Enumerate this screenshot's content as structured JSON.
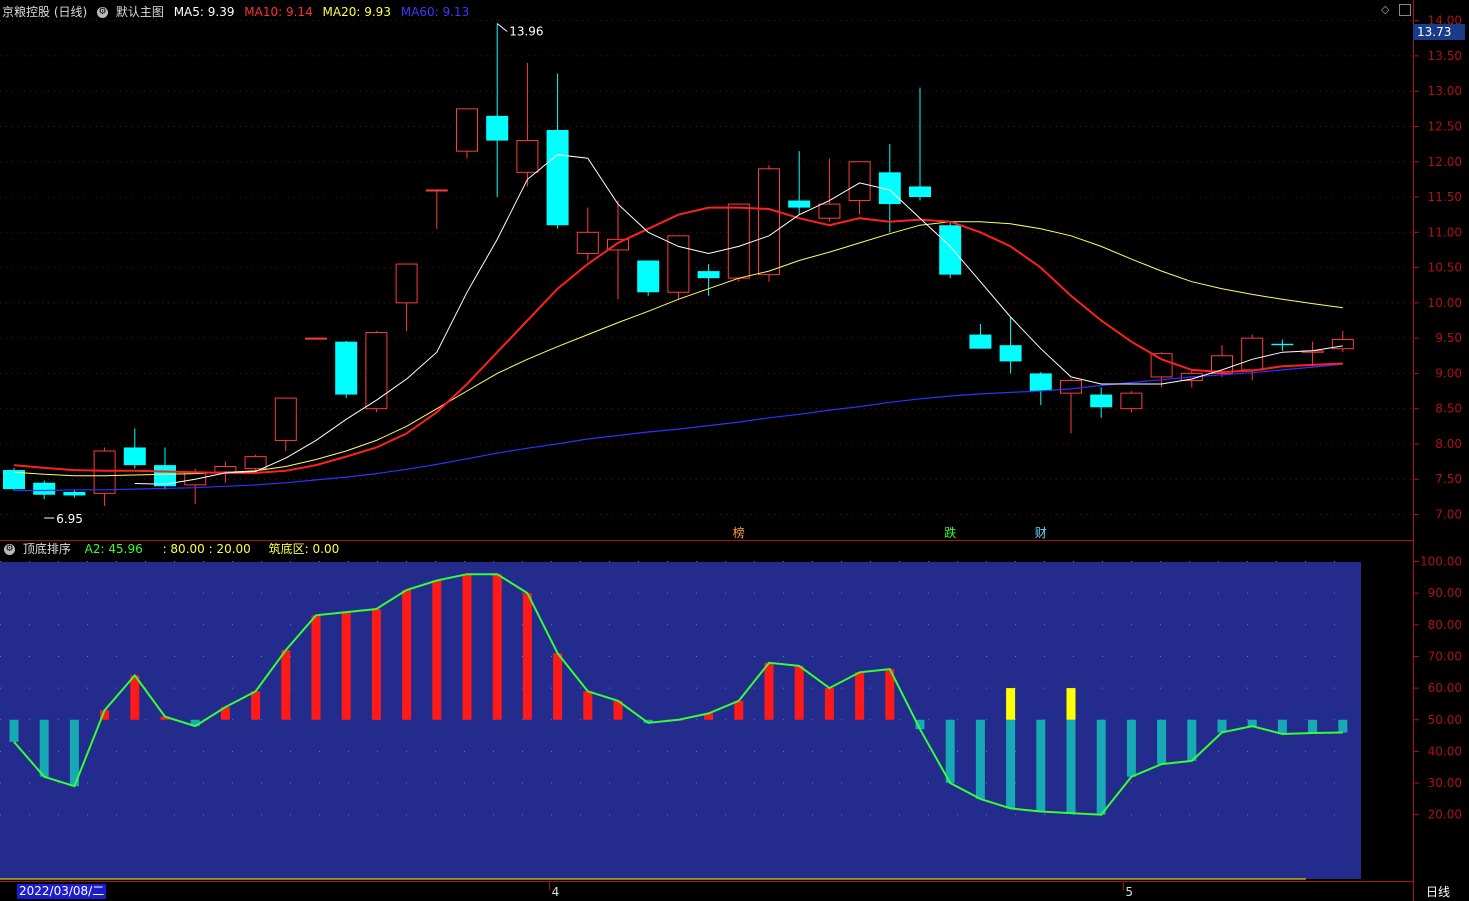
{
  "main_header": {
    "stock": "京粮控股 (日线)",
    "template": "默认主图",
    "ma5": "MA5: 9.39",
    "ma10": "MA10: 9.14",
    "ma20": "MA20: 9.93",
    "ma60": "MA60: 9.13"
  },
  "sub_header": {
    "title": "顶底排序",
    "a2": "A2: 45.96",
    "bounds": ": 80.00 : 20.00",
    "bottom": "筑底区: 0.00"
  },
  "current_price": "13.73",
  "bottom_bar": {
    "date": "2022/03/08/二",
    "period": "日线"
  },
  "colors": {
    "up": "#ff3b3b",
    "down": "#00ffff",
    "ma5": "#ffffff",
    "ma10": "#ff2020",
    "ma20": "#ffff66",
    "ma60": "#3030ff",
    "sub_bg": "#232b8c",
    "osc_line": "#33ff33",
    "osc_up": "#ff1a1a",
    "osc_down": "#17aab5",
    "osc_flag": "#ffff00",
    "axis": "#b01010"
  },
  "chart_data": [
    {
      "type": "candlestick",
      "ylim": [
        6.8,
        14.1
      ],
      "yticks": [
        7.0,
        7.5,
        8.0,
        8.5,
        9.0,
        9.5,
        10.0,
        10.5,
        11.0,
        11.5,
        12.0,
        12.5,
        13.0,
        13.5,
        14.0
      ],
      "ohlc": [
        [
          7.63,
          7.66,
          7.34,
          7.36
        ],
        [
          7.45,
          7.48,
          7.22,
          7.28
        ],
        [
          7.32,
          7.35,
          7.24,
          7.27
        ],
        [
          7.3,
          7.95,
          7.12,
          7.9
        ],
        [
          7.95,
          8.22,
          7.65,
          7.7
        ],
        [
          7.7,
          7.95,
          7.35,
          7.4
        ],
        [
          7.42,
          7.65,
          7.15,
          7.6
        ],
        [
          7.6,
          7.75,
          7.45,
          7.68
        ],
        [
          7.65,
          7.85,
          7.6,
          7.82
        ],
        [
          8.05,
          8.65,
          7.9,
          8.65
        ],
        [
          9.5,
          9.5,
          9.5,
          9.5
        ],
        [
          9.45,
          9.46,
          8.65,
          8.7
        ],
        [
          8.5,
          9.6,
          8.45,
          9.58
        ],
        [
          10.0,
          10.55,
          9.6,
          10.55
        ],
        [
          11.6,
          11.6,
          11.05,
          11.6
        ],
        [
          12.15,
          12.75,
          12.05,
          12.75
        ],
        [
          12.65,
          13.96,
          11.5,
          12.3
        ],
        [
          11.85,
          13.4,
          11.65,
          12.3
        ],
        [
          12.45,
          13.25,
          11.05,
          11.1
        ],
        [
          10.7,
          11.35,
          10.6,
          11.0
        ],
        [
          10.75,
          11.45,
          10.05,
          10.9
        ],
        [
          10.6,
          10.6,
          10.1,
          10.15
        ],
        [
          10.15,
          10.95,
          10.05,
          10.95
        ],
        [
          10.45,
          10.55,
          10.1,
          10.35
        ],
        [
          10.35,
          11.4,
          10.3,
          11.4
        ],
        [
          10.4,
          11.95,
          10.3,
          11.9
        ],
        [
          11.45,
          12.15,
          11.25,
          11.35
        ],
        [
          11.2,
          12.05,
          11.15,
          11.4
        ],
        [
          11.45,
          12.0,
          11.25,
          12.0
        ],
        [
          11.85,
          12.25,
          11.0,
          11.4
        ],
        [
          11.65,
          13.05,
          11.45,
          11.5
        ],
        [
          11.1,
          11.15,
          10.35,
          10.4
        ],
        [
          9.55,
          9.7,
          9.35,
          9.35
        ],
        [
          9.4,
          9.8,
          9.0,
          9.17
        ],
        [
          9.0,
          9.02,
          8.55,
          8.75
        ],
        [
          8.72,
          8.92,
          8.15,
          8.9
        ],
        [
          8.7,
          8.8,
          8.37,
          8.52
        ],
        [
          8.5,
          8.75,
          8.45,
          8.72
        ],
        [
          8.95,
          9.3,
          8.8,
          9.28
        ],
        [
          8.9,
          9.05,
          8.8,
          9.0
        ],
        [
          9.0,
          9.4,
          8.95,
          9.25
        ],
        [
          9.05,
          9.55,
          8.9,
          9.5
        ],
        [
          9.42,
          9.48,
          9.32,
          9.4
        ],
        [
          9.3,
          9.45,
          9.1,
          9.32
        ],
        [
          9.35,
          9.6,
          9.3,
          9.48
        ]
      ],
      "ma5": [
        null,
        null,
        null,
        null,
        7.44,
        7.43,
        7.5,
        7.59,
        7.61,
        7.8,
        8.05,
        8.35,
        8.62,
        8.92,
        9.3,
        10.15,
        10.9,
        11.75,
        12.1,
        12.05,
        11.4,
        11.0,
        10.8,
        10.7,
        10.8,
        10.95,
        11.25,
        11.45,
        11.7,
        11.6,
        11.2,
        10.8,
        10.3,
        9.8,
        9.35,
        8.95,
        8.85,
        8.85,
        8.85,
        8.92,
        9.05,
        9.2,
        9.3,
        9.32,
        9.39
      ],
      "ma10": [
        7.7,
        7.66,
        7.63,
        7.62,
        7.62,
        7.61,
        7.6,
        7.59,
        7.59,
        7.62,
        7.7,
        7.82,
        7.95,
        8.15,
        8.45,
        8.85,
        9.3,
        9.75,
        10.2,
        10.55,
        10.85,
        11.05,
        11.25,
        11.35,
        11.35,
        11.33,
        11.2,
        11.1,
        11.2,
        11.15,
        11.18,
        11.15,
        11.0,
        10.8,
        10.5,
        10.1,
        9.75,
        9.45,
        9.2,
        9.05,
        9.02,
        9.04,
        9.1,
        9.12,
        9.14
      ],
      "ma20": [
        7.6,
        7.57,
        7.55,
        7.55,
        7.56,
        7.57,
        7.58,
        7.6,
        7.62,
        7.68,
        7.78,
        7.9,
        8.05,
        8.25,
        8.5,
        8.75,
        9.0,
        9.2,
        9.38,
        9.55,
        9.72,
        9.88,
        10.05,
        10.2,
        10.35,
        10.45,
        10.6,
        10.72,
        10.85,
        10.98,
        11.1,
        11.15,
        11.15,
        11.12,
        11.05,
        10.95,
        10.8,
        10.62,
        10.45,
        10.3,
        10.2,
        10.12,
        10.05,
        9.99,
        9.93
      ],
      "ma60": [
        7.34,
        7.34,
        7.35,
        7.35,
        7.36,
        7.37,
        7.38,
        7.4,
        7.42,
        7.45,
        7.49,
        7.53,
        7.58,
        7.64,
        7.71,
        7.79,
        7.87,
        7.94,
        8.0,
        8.07,
        8.12,
        8.17,
        8.21,
        8.26,
        8.31,
        8.37,
        8.42,
        8.48,
        8.53,
        8.59,
        8.64,
        8.68,
        8.71,
        8.73,
        8.75,
        8.78,
        8.83,
        8.87,
        8.91,
        8.95,
        8.98,
        9.01,
        9.05,
        9.09,
        9.13
      ],
      "labels": [
        {
          "text": "13.96",
          "bar": 16,
          "value": 13.96
        },
        {
          "text": "6.95",
          "bar": 1,
          "value": 6.95
        }
      ],
      "events": [
        {
          "text": "榜",
          "bar": 24,
          "color": "#ff9944"
        },
        {
          "text": "跌",
          "bar": 31,
          "color": "#33ff33"
        },
        {
          "text": "财",
          "bar": 34,
          "color": "#66ddff"
        }
      ]
    },
    {
      "type": "bar",
      "title": "顶底排序",
      "baseline": 50,
      "ylim": [
        0,
        105
      ],
      "yticks": [
        20,
        30,
        40,
        50,
        60,
        70,
        80,
        90,
        100
      ],
      "values": [
        43,
        32,
        29,
        53,
        64,
        51,
        48,
        54,
        59,
        72,
        83,
        84,
        85,
        91,
        94,
        96,
        96,
        90,
        71,
        59,
        56,
        49,
        50,
        52,
        56,
        68,
        67,
        60,
        65,
        66,
        47,
        30,
        25,
        22,
        21,
        20.5,
        20,
        32,
        36,
        37,
        46,
        48,
        45.5,
        45.8,
        45.96
      ],
      "flags": [
        {
          "bar": 33,
          "value": 60
        },
        {
          "bar": 35,
          "value": 60
        }
      ]
    }
  ],
  "x_axis_months": [
    {
      "text": "4",
      "bar": 18
    },
    {
      "text": "5",
      "bar": 37
    }
  ]
}
